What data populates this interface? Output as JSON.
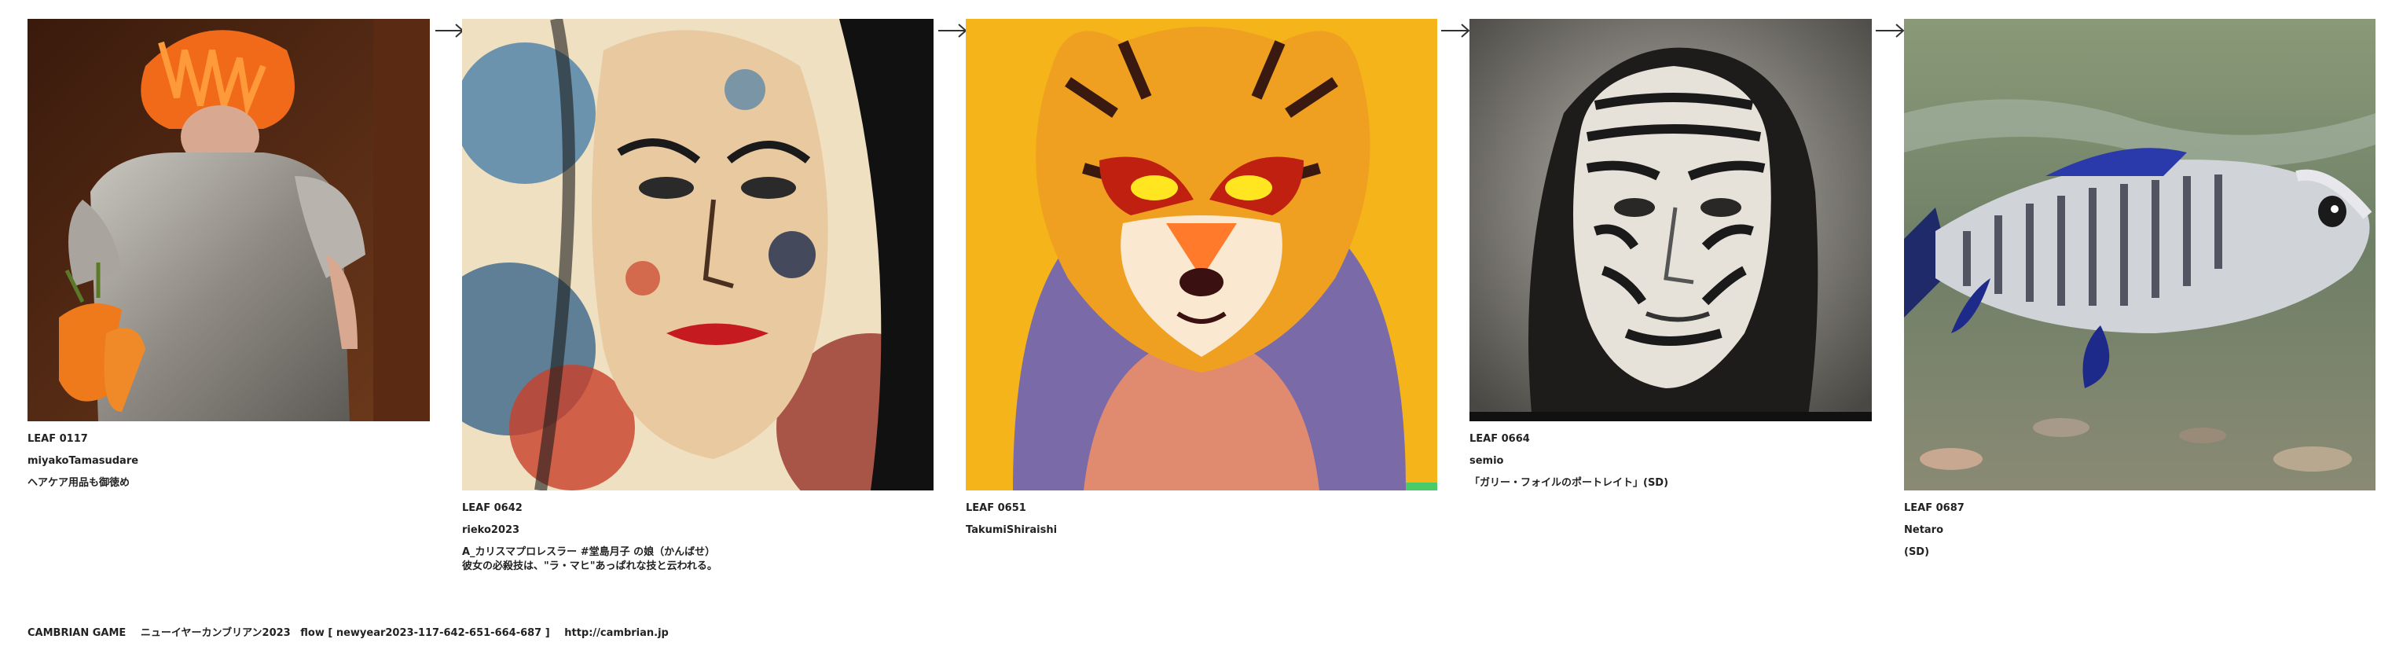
{
  "cards": [
    {
      "leaf": "LEAF 0117",
      "author": "miyakoTamasudare",
      "caption": [
        "ヘアケア用品も御徳め"
      ]
    },
    {
      "leaf": "LEAF 0642",
      "author": "rieko2023",
      "caption": [
        "A_カリスマプロレスラー #堂島月子 の娘（かんばせ）",
        "彼女の必殺技は、\"ラ・マヒ\"あっぱれな技と云われる。"
      ]
    },
    {
      "leaf": "LEAF 0651",
      "author": "TakumiShiraishi",
      "caption": []
    },
    {
      "leaf": "LEAF 0664",
      "author": "semio",
      "caption": [
        "「ガリー・フォイルのポートレイト」(SD)"
      ]
    },
    {
      "leaf": "LEAF 0687",
      "author": "Netaro",
      "caption": [
        "(SD)"
      ]
    }
  ],
  "footer": {
    "game": "CAMBRIAN GAME",
    "title": "ニューイヤーカンブリアン2023",
    "flow": "flow [ newyear2023-117-642-651-664-687 ]",
    "url": "http://cambrian.jp"
  },
  "icons": [
    "arrow-right-icon"
  ]
}
